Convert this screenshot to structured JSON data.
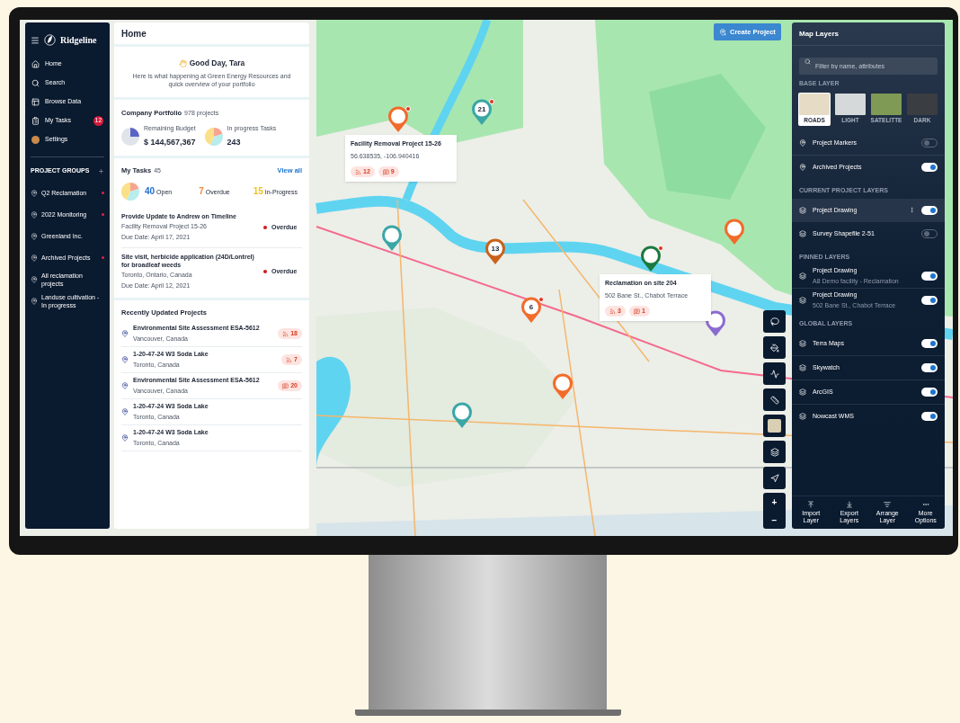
{
  "sidebar": {
    "brand": "Ridgeline",
    "nav": [
      {
        "label": "Home",
        "kind": "icon",
        "selected": false
      },
      {
        "label": "Search",
        "kind": "icon",
        "selected": false
      },
      {
        "label": "Browse Data",
        "kind": "icon",
        "selected": false
      },
      {
        "label": "My Tasks",
        "kind": "icon",
        "badge": "12",
        "selected": false
      },
      {
        "label": "Settings",
        "kind": "avatar",
        "selected": false
      }
    ],
    "groups_title": "PROJECT GROUPS",
    "groups": [
      {
        "label": "Q2 Reclamation",
        "alert": true
      },
      {
        "label": "2022 Monitoring",
        "alert": true
      },
      {
        "label": "Greenland Inc.",
        "alert": false
      },
      {
        "label": "Archived Projects",
        "alert": true
      },
      {
        "label": "All reclamation projects",
        "alert": false
      },
      {
        "label": "Landuse cultivation - In progresss",
        "alert": false
      }
    ]
  },
  "home": {
    "title": "Home",
    "greeting": "Good Day, Tara",
    "intro": "Here is what happening at Green Energy Resources and quick overview of your portfolio",
    "portfolio": {
      "title": "Company Portfolio",
      "count": "978 projects",
      "stats": [
        {
          "label": "Remaining Budget",
          "value": "$ 144,567,367"
        },
        {
          "label": "In progress Tasks",
          "value": "243"
        }
      ]
    },
    "tasks": {
      "title": "My Tasks",
      "count": "45",
      "link": "View all",
      "summary": [
        {
          "value": "40",
          "label": "Open",
          "color": "#1d6fd1"
        },
        {
          "value": "7",
          "label": "Overdue",
          "color": "#f08a3c"
        },
        {
          "value": "15",
          "label": "In-Progress",
          "color": "#f2c21b"
        }
      ],
      "items": [
        {
          "title": "Provide Update to Andrew on Timeline",
          "subtitle": "Facility Removal Project 15-26",
          "due": "Due Date: April 17, 2021",
          "status": "Overdue"
        },
        {
          "title": "Site visit, herbicide application (24D/Lontrel) for broadleaf weeds",
          "subtitle": "Toronto, Ontario, Canada",
          "due": "Due Date: April 12, 2021",
          "status": "Overdue"
        }
      ]
    },
    "recent": {
      "title": "Recently Updated Projects",
      "items": [
        {
          "title": "Environmental Site Assessment  ESA-5612",
          "location": "Vancouver, Canada",
          "badge": {
            "kind": "feed",
            "count": "18"
          }
        },
        {
          "title": "1-20-47-24 W3 Soda Lake",
          "location": "Toronto, Canada",
          "badge": {
            "kind": "feed",
            "count": "7"
          }
        },
        {
          "title": "Environmental Site Assessment  ESA-5612",
          "location": "Vancouver, Canada",
          "badge": {
            "kind": "comment",
            "count": "20"
          }
        },
        {
          "title": "1-20-47-24 W3 Soda Lake",
          "location": "Toronto, Canada"
        },
        {
          "title": "1-20-47-24 W3 Soda Lake",
          "location": "Toronto, Canada"
        }
      ]
    }
  },
  "map": {
    "create_button": "Create Project",
    "markers": [
      {
        "color": "#f26b2a",
        "alert": true
      },
      {
        "color": "#3aa6a6",
        "label": "21",
        "alert": true
      },
      {
        "color": "#3aa6a6",
        "alert": false
      },
      {
        "color": "#c8621a",
        "label": "13",
        "alert": false
      },
      {
        "color": "#1b7a3e",
        "alert": true
      },
      {
        "color": "#f26b2a",
        "label": "6",
        "alert": true
      },
      {
        "color": "#f26b2a",
        "alert": false
      },
      {
        "color": "#8b6bd1",
        "alert": false
      },
      {
        "color": "#f26b2a",
        "alert": false
      },
      {
        "color": "#3aa6a6",
        "alert": false
      }
    ],
    "popups": [
      {
        "title": "Facility Removal Project 15-26",
        "subtitle": "56.638535, -106.940416",
        "stats": [
          {
            "kind": "feed",
            "value": "12"
          },
          {
            "kind": "comment",
            "value": "9"
          }
        ]
      },
      {
        "title": "Reclamation on site 204",
        "subtitle": "502 Bane St., Chabot Terrace",
        "stats": [
          {
            "kind": "feed",
            "value": "3"
          },
          {
            "kind": "comment",
            "value": "1"
          }
        ]
      }
    ],
    "zoom": [
      "+",
      "−"
    ]
  },
  "layers": {
    "title": "Map Layers",
    "search": {
      "placeholder": "Filter by name, attributes"
    },
    "base_title": "BASE LAYER",
    "base": [
      {
        "label": "ROADS",
        "selected": true
      },
      {
        "label": "LIGHT",
        "selected": false
      },
      {
        "label": "SATELITTE",
        "selected": false
      },
      {
        "label": "DARK",
        "selected": false
      }
    ],
    "markers": [
      {
        "label": "Project Markers",
        "on": false
      },
      {
        "label": "Archived Projects",
        "on": true
      }
    ],
    "current_title": "CURRENT PROJECT LAYERS",
    "current": [
      {
        "label": "Project Drawing",
        "on": true,
        "selected": true
      },
      {
        "label": "Survey Shapefile 2-51",
        "on": false,
        "selected": false
      }
    ],
    "pinned_title": "PINNED LAYERS",
    "pinned": [
      {
        "label": "Project Drawing",
        "subtitle": "A8 Demo facility  - Reclamation",
        "on": true
      },
      {
        "label": "Project Drawing",
        "subtitle": "502 Bane St., Chabot Terrace",
        "on": true
      }
    ],
    "global_title": "GLOBAL LAYERS",
    "global": [
      {
        "label": "Terra Maps",
        "on": true
      },
      {
        "label": "Skywatch",
        "on": true
      },
      {
        "label": "ArcGIS",
        "on": true
      },
      {
        "label": "Nowcast WMS",
        "on": true
      }
    ],
    "actions": [
      {
        "label": "Import Layer"
      },
      {
        "label": "Export Layers"
      },
      {
        "label": "Arrange Layer"
      },
      {
        "label": "More Options"
      }
    ]
  }
}
